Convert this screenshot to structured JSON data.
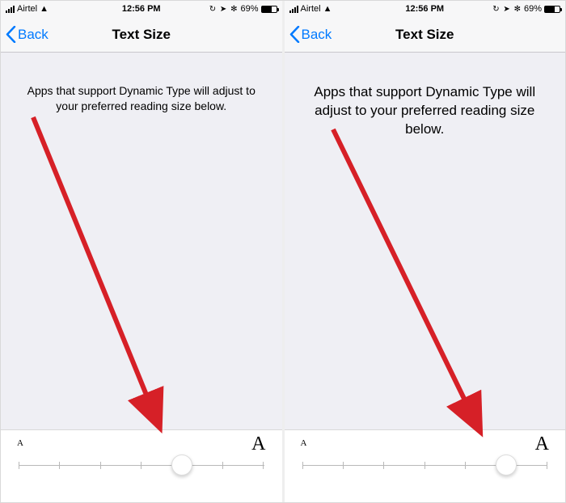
{
  "status": {
    "carrier": "Airtel",
    "time": "12:56 PM",
    "battery": "69%",
    "indicators": "⚙ ⤴ ⚡"
  },
  "nav": {
    "back": "Back",
    "title": "Text Size"
  },
  "desc": "Apps that support Dynamic Type will adjust to your preferred reading size below.",
  "slider": {
    "min_label": "A",
    "max_label": "A",
    "steps": 7,
    "left_value_index": 4,
    "right_value_index": 5
  }
}
